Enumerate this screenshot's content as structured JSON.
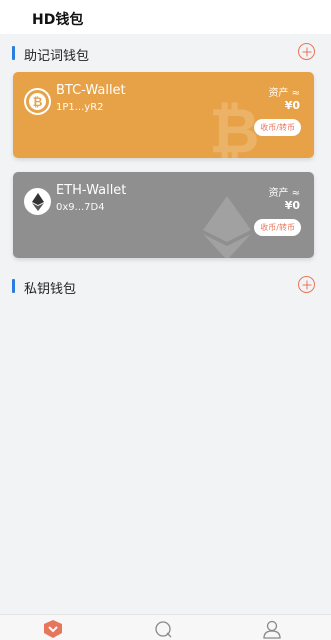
{
  "header": {
    "title": "HD钱包"
  },
  "mnemonic_section": {
    "label": "助记词钱包"
  },
  "private_key_section": {
    "label": "私钥钱包"
  },
  "wallets": [
    {
      "name": "BTC-Wallet",
      "address": "1P1...yR2",
      "asset_label": "资产 ≈",
      "asset_value": "¥0",
      "action_label": "收币/转币",
      "color": "#e7a247",
      "icon": "bitcoin-icon"
    },
    {
      "name": "ETH-Wallet",
      "address": "0x9...7D4",
      "asset_label": "资产 ≈",
      "asset_value": "¥0",
      "action_label": "收币/转币",
      "color": "#8f8f8f",
      "icon": "ethereum-icon"
    }
  ],
  "tabbar": {
    "items": [
      {
        "icon": "wallet-home-icon",
        "active": true
      },
      {
        "icon": "discover-icon",
        "active": false
      },
      {
        "icon": "profile-icon",
        "active": false
      }
    ]
  },
  "colors": {
    "accent": "#e8765b",
    "section_marker": "#2a7de1"
  }
}
